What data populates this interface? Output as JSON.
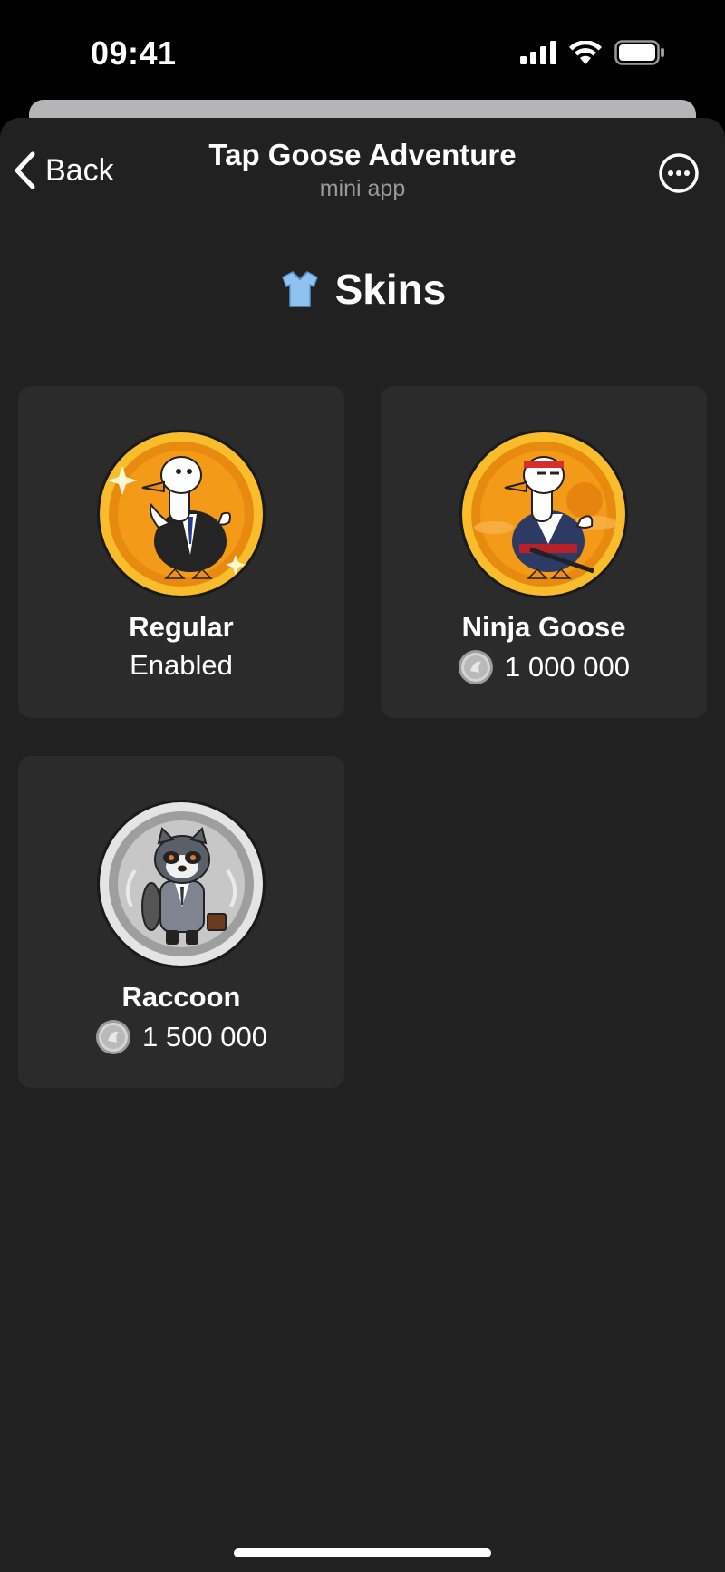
{
  "status_bar": {
    "time": "09:41"
  },
  "header": {
    "back_label": "Back",
    "title": "Tap Goose Adventure",
    "subtitle": "mini app"
  },
  "section": {
    "icon": "shirt-icon",
    "title": "Skins"
  },
  "skins": [
    {
      "name": "Regular",
      "status": "Enabled",
      "price": null,
      "coin": "gold"
    },
    {
      "name": "Ninja Goose",
      "status": null,
      "price": "1 000 000",
      "coin": "gold"
    },
    {
      "name": "Raccoon",
      "status": null,
      "price": "1 500 000",
      "coin": "silver"
    }
  ],
  "colors": {
    "background": "#212121",
    "card": "#2b2b2b",
    "gold": "#f5a312",
    "silver": "#cfcfcf"
  }
}
